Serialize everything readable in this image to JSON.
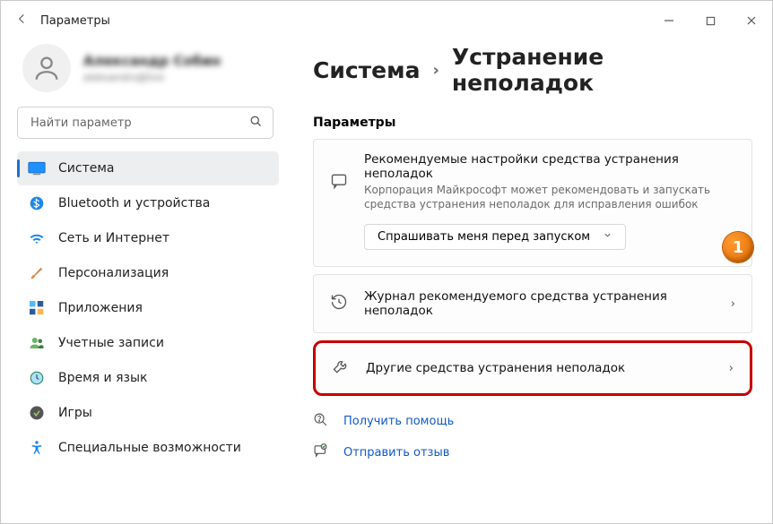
{
  "window": {
    "title": "Параметры"
  },
  "profile": {
    "name": "Александр Собин",
    "sub": "aleksandrs@live"
  },
  "search": {
    "placeholder": "Найти параметр"
  },
  "sidebar": {
    "items": [
      {
        "label": "Система"
      },
      {
        "label": "Bluetooth и устройства"
      },
      {
        "label": "Сеть и Интернет"
      },
      {
        "label": "Персонализация"
      },
      {
        "label": "Приложения"
      },
      {
        "label": "Учетные записи"
      },
      {
        "label": "Время и язык"
      },
      {
        "label": "Игры"
      },
      {
        "label": "Специальные возможности"
      }
    ]
  },
  "breadcrumb": {
    "parent": "Система",
    "current": "Устранение неполадок"
  },
  "section_header": "Параметры",
  "recommended": {
    "title": "Рекомендуемые настройки средства устранения неполадок",
    "desc": "Корпорация Майкрософт может рекомендовать и запускать средства устранения неполадок для исправления ошибок",
    "dropdown": "Спрашивать меня перед запуском"
  },
  "rows": {
    "history": "Журнал рекомендуемого средства устранения неполадок",
    "other": "Другие средства устранения неполадок"
  },
  "links": {
    "help": "Получить помощь",
    "feedback": "Отправить отзыв"
  },
  "annotation": {
    "badge": "1"
  }
}
